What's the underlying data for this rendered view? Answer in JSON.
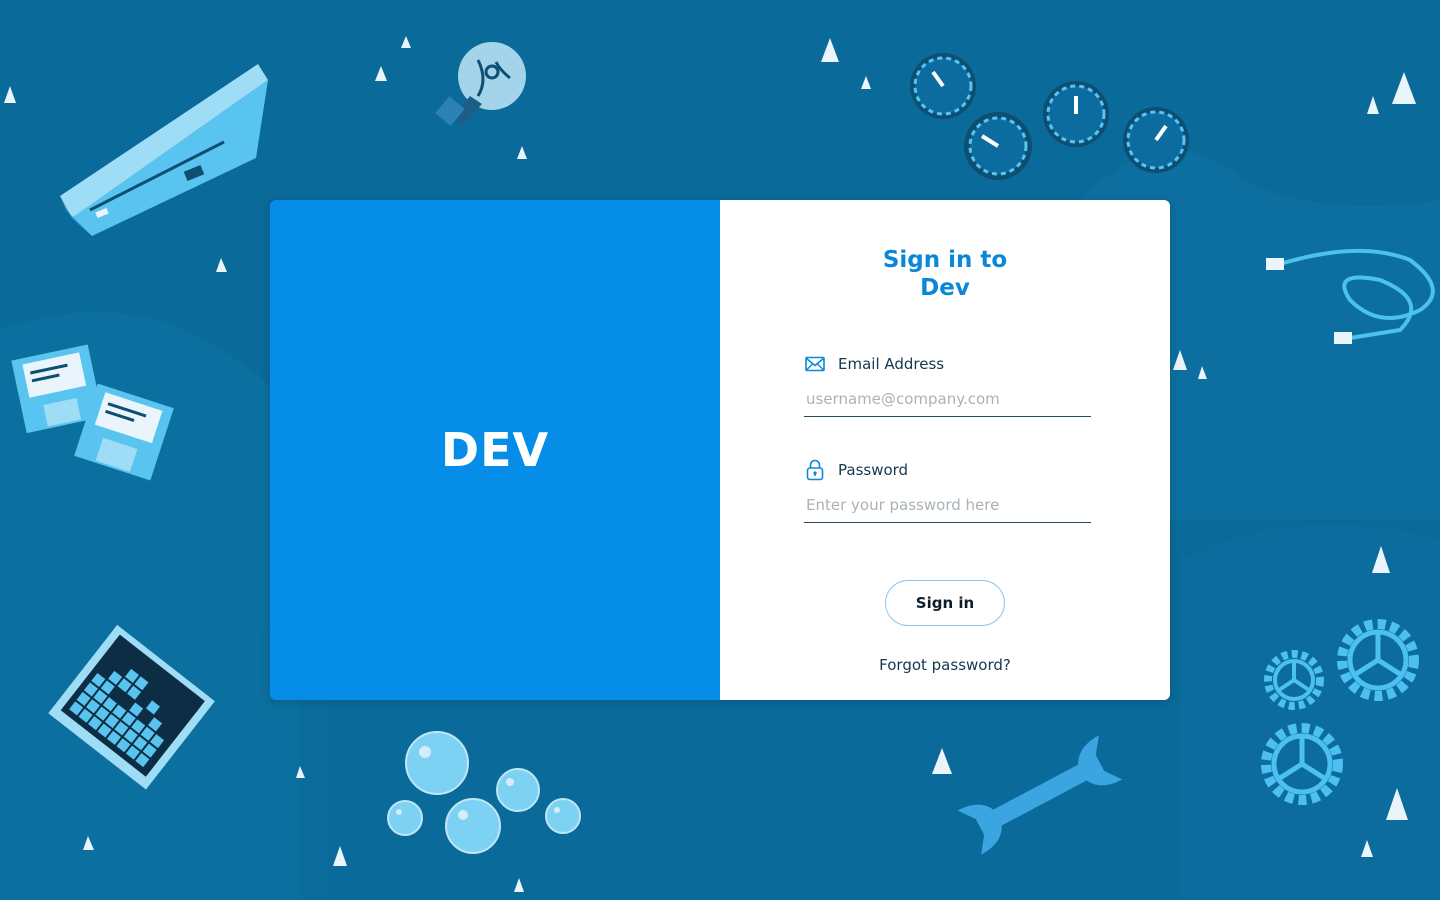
{
  "brand": {
    "name": "DEV"
  },
  "signin": {
    "title_line1": "Sign in to",
    "title_line2": "Dev",
    "email_label": "Email Address",
    "email_placeholder": "username@company.com",
    "email_value": "",
    "email_icon": "envelope-icon",
    "password_label": "Password",
    "password_placeholder": "Enter your password here",
    "password_value": "",
    "password_icon": "lock-icon",
    "submit_label": "Sign in",
    "forgot_label": "Forgot password?"
  },
  "background": {
    "illustrations": [
      "floppy-drive-icon",
      "lightbulb-icon",
      "stopwatch-icon",
      "network-cable-icon",
      "floppy-disk-icon",
      "circuit-chip-icon",
      "bubbles-icon",
      "wrench-icon",
      "gear-icon"
    ]
  },
  "colors": {
    "background": "#0a6a9a",
    "brand_panel": "#058de8",
    "title": "#0a87d8",
    "text": "#14384f"
  }
}
